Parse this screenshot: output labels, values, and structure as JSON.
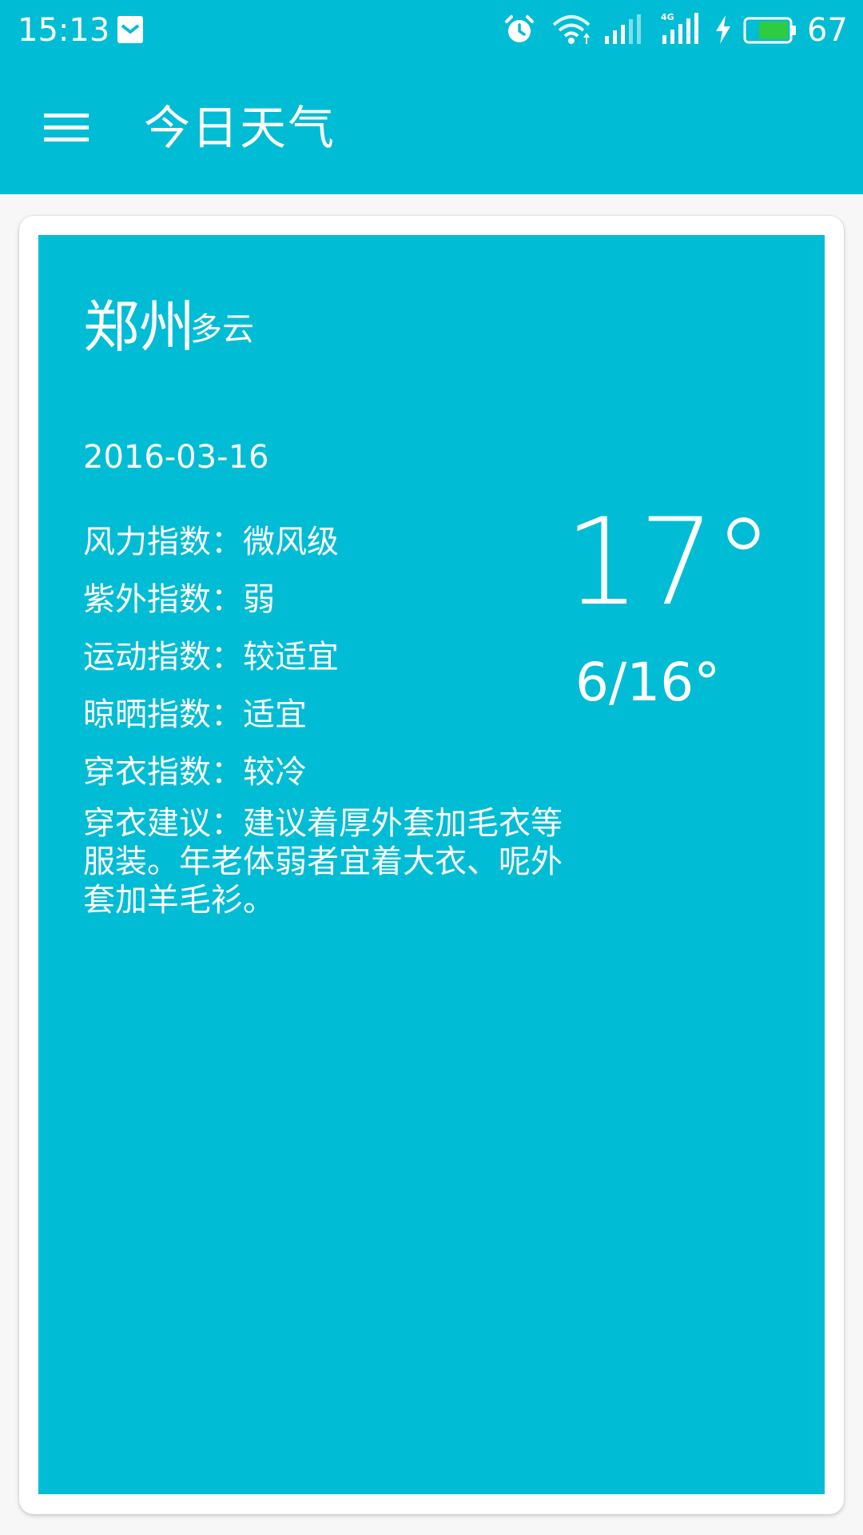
{
  "status_bar": {
    "time": "15:13",
    "battery_level": "67",
    "colors": {
      "battery_fill": "#2ecc40"
    },
    "icons": [
      "message-icon",
      "alarm-icon",
      "wifi-icon",
      "signal-icon",
      "signal-4g-icon",
      "charging-icon",
      "battery-icon"
    ]
  },
  "app_bar": {
    "title": "今日天气",
    "menu_icon": "menu-icon"
  },
  "weather": {
    "city": "郑州",
    "condition": "多云",
    "date": "2016-03-16",
    "current_temp": "17°",
    "temp_range": "6/16°",
    "indices": [
      {
        "label": "风力指数：微风级"
      },
      {
        "label": "紫外指数：弱"
      },
      {
        "label": "运动指数：较适宜"
      },
      {
        "label": "晾晒指数：适宜"
      },
      {
        "label": "穿衣指数：较冷"
      }
    ],
    "advice": "穿衣建议：建议着厚外套加毛衣等服装。年老体弱者宜着大衣、呢外套加羊毛衫。"
  },
  "colors": {
    "primary": "#00bcd4",
    "background": "#f7f7f7",
    "card": "#ffffff",
    "text": "#ffffff"
  }
}
